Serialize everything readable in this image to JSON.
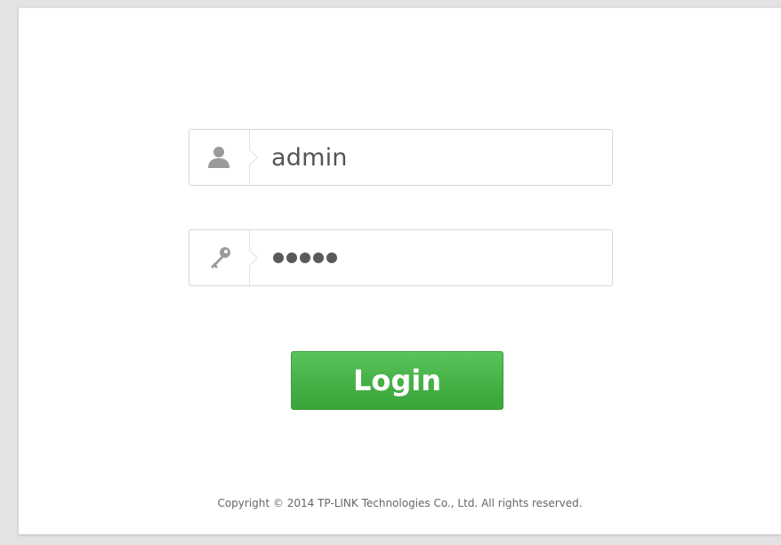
{
  "login_form": {
    "username": {
      "value": "admin",
      "icon": "user-icon"
    },
    "password": {
      "masked_length": 5,
      "icon": "key-icon"
    },
    "login_button_label": "Login"
  },
  "footer": {
    "copyright": "Copyright © 2014 TP-LINK Technologies Co., Ltd. All rights reserved."
  },
  "colors": {
    "background": "#e3e3e3",
    "panel": "#ffffff",
    "button_green": "#45b045",
    "input_text": "#555555",
    "border": "#d8d8d8"
  }
}
